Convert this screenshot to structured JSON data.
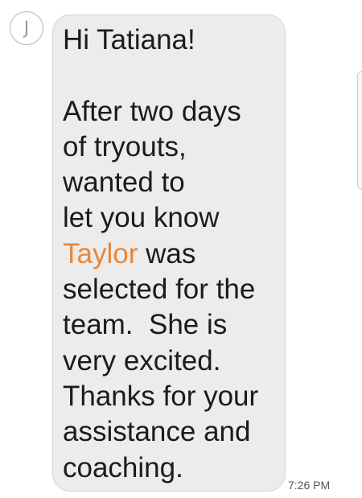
{
  "contact": {
    "avatar_initial": "J"
  },
  "message": {
    "greeting": "Hi Tatiana!",
    "part_before_name": "After two days\nof tryouts,\nwanted to\nlet you know\n",
    "highlighted_name": "Taylor",
    "part_after_name": " was\nselected for the\nteam.  She is\nvery excited.\nThanks for your\nassistance and\ncoaching.",
    "timestamp": "7:26 PM"
  },
  "colors": {
    "bubble_background": "#ececec",
    "highlight": "#e8863a",
    "text": "#1b1b1b"
  }
}
